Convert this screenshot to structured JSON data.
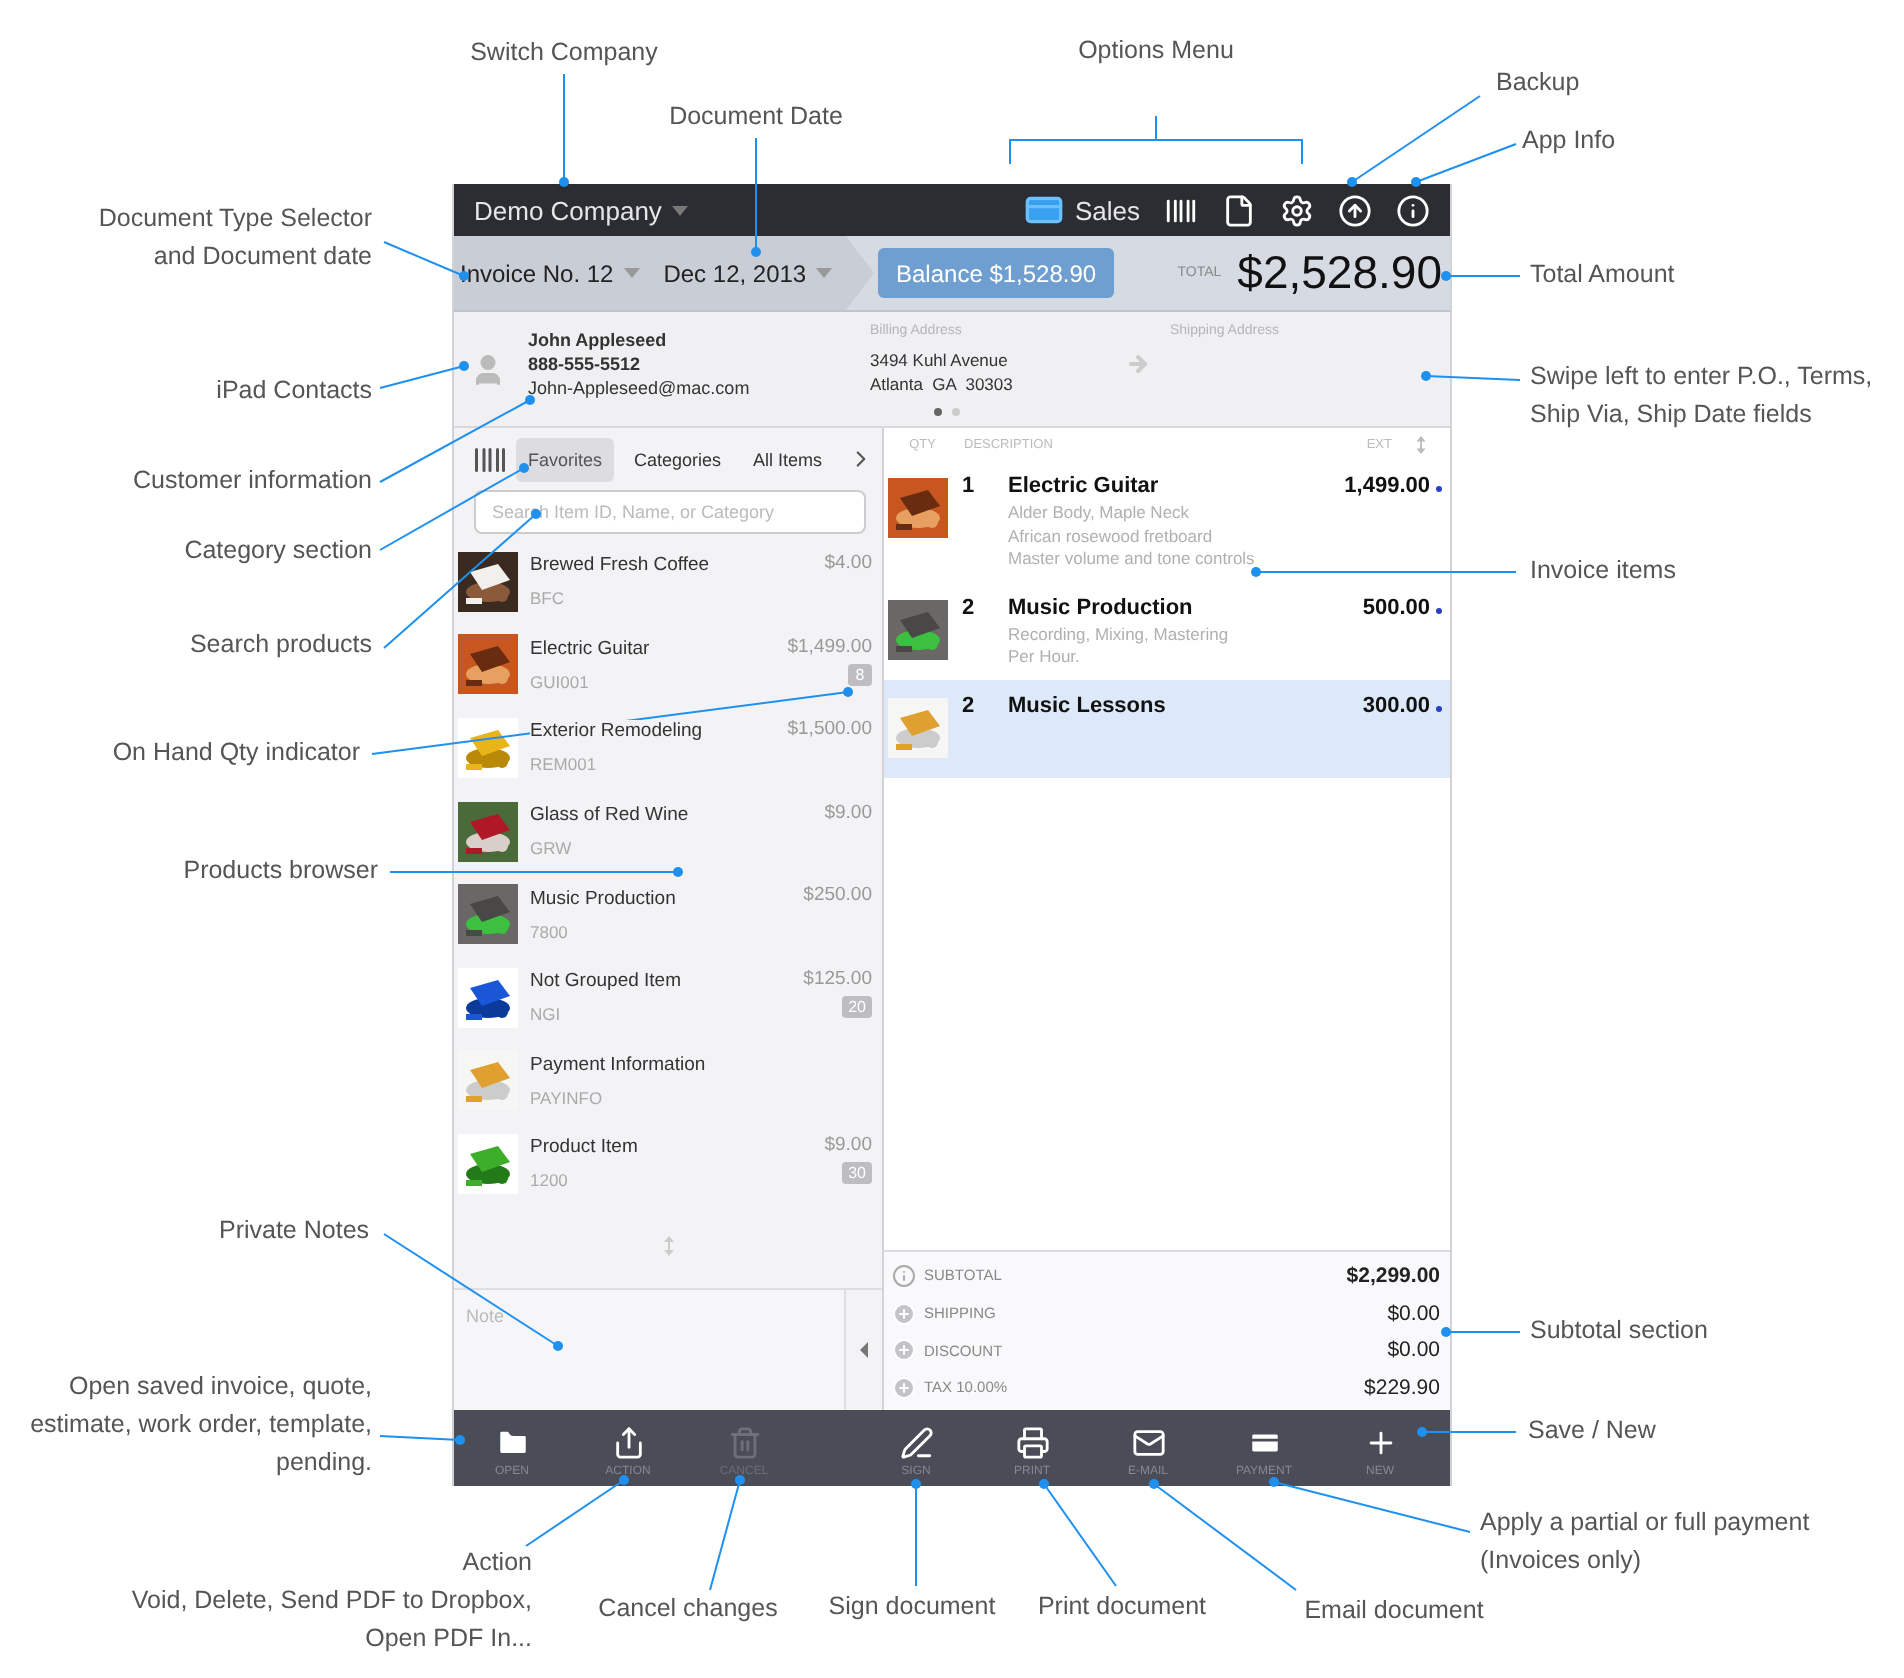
{
  "top_bar": {
    "company": "Demo Company",
    "mode": "Sales"
  },
  "document_bar": {
    "doc_type": "Invoice No. 12",
    "date": "Dec 12, 2013",
    "balance": "Balance $1,528.90",
    "total_label": "TOTAL",
    "total": "$2,528.90"
  },
  "customer": {
    "name": "John Appleseed",
    "phone": "888-555-5512",
    "email": "John-Appleseed@mac.com",
    "billing_label": "Billing Address",
    "billing_lines": [
      "3494 Kuhl Avenue",
      "Atlanta  GA  30303"
    ],
    "shipping_label": "Shipping Address",
    "pages": [
      {
        "selected": true
      },
      {
        "selected": false
      }
    ]
  },
  "product_tabs": [
    {
      "label": "Favorites",
      "selected": true
    },
    {
      "label": "Categories",
      "selected": false
    },
    {
      "label": "All Items",
      "selected": false
    }
  ],
  "search": {
    "placeholder": "Search Item ID, Name, or Category"
  },
  "products": [
    {
      "name": "Brewed Fresh Coffee",
      "price": "$4.00",
      "code": "BFC"
    },
    {
      "name": "Electric Guitar",
      "price": "$1,499.00",
      "code": "GUI001",
      "on_hand": "8"
    },
    {
      "name": "Exterior Remodeling",
      "price": "$1,500.00",
      "code": "REM001"
    },
    {
      "name": "Glass of Red Wine",
      "price": "$9.00",
      "code": "GRW"
    },
    {
      "name": "Music Production",
      "price": "$250.00",
      "code": "7800"
    },
    {
      "name": "Not Grouped Item",
      "price": "$125.00",
      "code": "NGI",
      "on_hand": "20"
    },
    {
      "name": "Payment Information",
      "code": "PAYINFO"
    },
    {
      "name": "Product Item",
      "price": "$9.00",
      "code": "1200",
      "on_hand": "30"
    }
  ],
  "note": {
    "placeholder": "Note"
  },
  "invoice_columns": [
    "QTY",
    "DESCRIPTION",
    "EXT"
  ],
  "invoice_items": [
    {
      "qty": "1",
      "name": "Electric Guitar",
      "details": [
        "Alder Body, Maple Neck",
        "African rosewood fretboard",
        "Master volume and tone controls"
      ],
      "ext": "1,499.00",
      "selected": false
    },
    {
      "qty": "2",
      "name": "Music Production",
      "details": [
        "Recording, Mixing, Mastering",
        "Per Hour."
      ],
      "ext": "500.00",
      "selected": false
    },
    {
      "qty": "2",
      "name": "Music Lessons",
      "ext": "300.00",
      "selected": true
    }
  ],
  "totals": [
    {
      "kind": "info",
      "label": "SUBTOTAL",
      "value": "$2,299.00"
    },
    {
      "kind": "add",
      "label": "SHIPPING",
      "value": "$0.00"
    },
    {
      "kind": "add",
      "label": "DISCOUNT",
      "value": "$0.00"
    },
    {
      "kind": "add",
      "label": "TAX 10.00%",
      "value": "$229.90"
    }
  ],
  "toolbar": [
    {
      "label": "OPEN",
      "disabled": false
    },
    {
      "label": "ACTION",
      "disabled": false
    },
    {
      "label": "CANCEL",
      "disabled": true
    },
    {
      "label": "SIGN",
      "disabled": false
    },
    {
      "label": "PRINT",
      "disabled": false
    },
    {
      "label": "E-MAIL",
      "disabled": false
    },
    {
      "label": "PAYMENT",
      "disabled": false
    },
    {
      "label": "NEW",
      "disabled": false
    }
  ],
  "annotations": [
    {
      "lines": [
        "Switch Company"
      ]
    },
    {
      "lines": [
        "Document Date"
      ]
    },
    {
      "lines": [
        "Options Menu"
      ]
    },
    {
      "lines": [
        "Backup"
      ]
    },
    {
      "lines": [
        "App Info"
      ]
    },
    {
      "lines": [
        "Document Type Selector",
        "and Document date"
      ]
    },
    {
      "lines": [
        "Total Amount"
      ]
    },
    {
      "lines": [
        "iPad Contacts"
      ]
    },
    {
      "lines": [
        "Swipe left to enter P.O., Terms,",
        "Ship Via, Ship Date fields"
      ]
    },
    {
      "lines": [
        "Customer information"
      ]
    },
    {
      "lines": [
        "Category section"
      ]
    },
    {
      "lines": [
        "Invoice items"
      ]
    },
    {
      "lines": [
        "Search products"
      ]
    },
    {
      "lines": [
        "On Hand Qty indicator"
      ]
    },
    {
      "lines": [
        "Products browser"
      ]
    },
    {
      "lines": [
        "Private Notes"
      ]
    },
    {
      "lines": [
        "Subtotal section"
      ]
    },
    {
      "lines": [
        "Open saved invoice, quote,",
        "estimate, work order, template,",
        "pending."
      ]
    },
    {
      "lines": [
        "Save / New"
      ]
    },
    {
      "lines": [
        "Apply a partial or full payment",
        "(Invoices only)"
      ]
    },
    {
      "lines": [
        "Action",
        "Void, Delete, Send PDF to Dropbox,",
        "Open PDF In..."
      ]
    },
    {
      "lines": [
        "Cancel changes"
      ]
    },
    {
      "lines": [
        "Sign document"
      ]
    },
    {
      "lines": [
        "Print document"
      ]
    },
    {
      "lines": [
        "Email document"
      ]
    }
  ]
}
